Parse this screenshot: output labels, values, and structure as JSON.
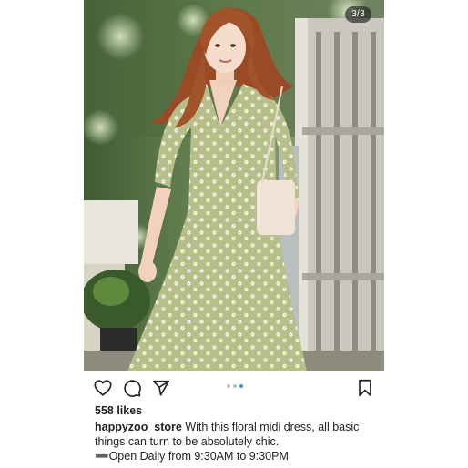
{
  "post": {
    "slide_counter": "3/3",
    "carousel": {
      "total": 3,
      "active_index": 2
    },
    "likes": "558 likes",
    "username": "happyzoo_store",
    "caption_text": "With this floral midi dress, all basic things can turn to be absolutely chic.",
    "caption_line3": "➖Open Daily from 9:30AM to 9:30PM",
    "icons": {
      "like": "heart-icon",
      "comment": "comment-icon",
      "share": "send-icon",
      "save": "bookmark-icon"
    }
  },
  "colors": {
    "dot_active": "#3897f0",
    "dot_inactive": "#a8c2d6",
    "dress": "#b6be8a",
    "hair": "#9a4a24"
  }
}
